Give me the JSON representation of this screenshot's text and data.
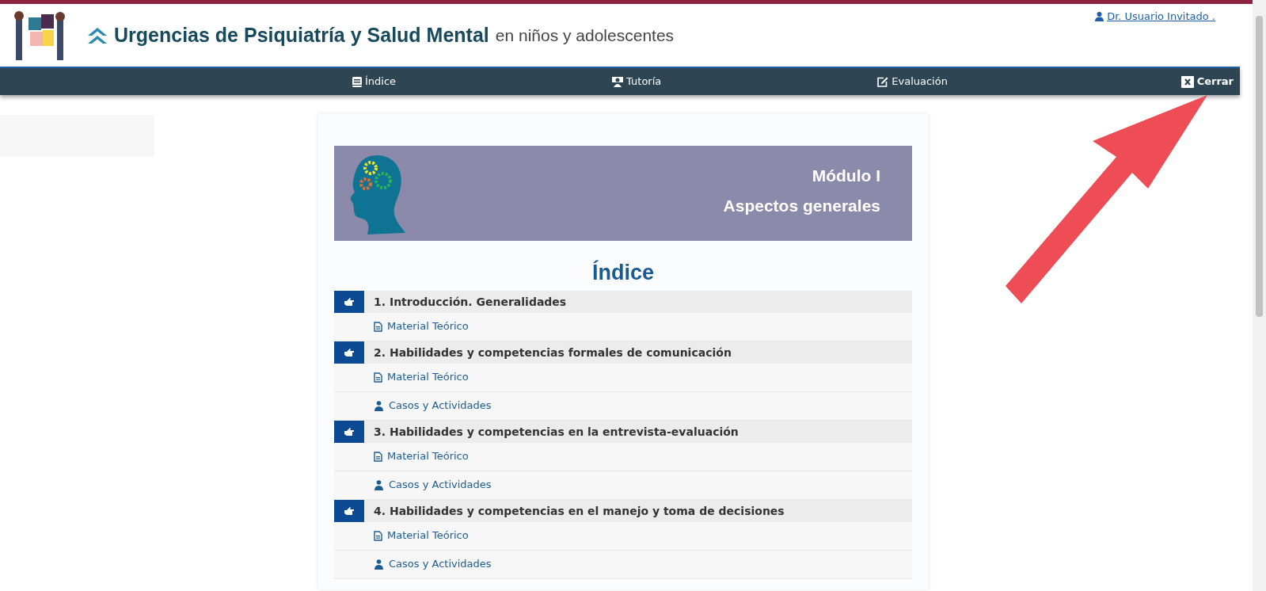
{
  "header": {
    "user": "Dr. Usuario Invitado .",
    "title": "Urgencias de Psiquiatría y Salud Mental",
    "subtitle": "en niños y adolescentes"
  },
  "nav": [
    {
      "label": "Índice",
      "kind": "book"
    },
    {
      "label": "Tutoría",
      "kind": "teacher"
    },
    {
      "label": "Evaluación",
      "kind": "edit"
    }
  ],
  "close": "Cerrar",
  "banner": {
    "module": "Módulo I",
    "name": "Aspectos generales"
  },
  "index_title": "Índice",
  "sections": [
    {
      "title": "1. Introducción. Generalidades",
      "items": [
        {
          "kind": "theory",
          "label": "Material Teórico"
        }
      ]
    },
    {
      "title": "2. Habilidades y competencias formales de comunicación",
      "items": [
        {
          "kind": "theory",
          "label": "Material Teórico"
        },
        {
          "kind": "cases",
          "label": "Casos y Actividades"
        }
      ]
    },
    {
      "title": "3. Habilidades y competencias en la entrevista-evaluación",
      "items": [
        {
          "kind": "theory",
          "label": "Material Teórico"
        },
        {
          "kind": "cases",
          "label": "Casos y Actividades"
        }
      ]
    },
    {
      "title": "4. Habilidades y competencias en el manejo y toma de decisiones",
      "items": [
        {
          "kind": "theory",
          "label": "Material Teórico"
        },
        {
          "kind": "cases",
          "label": "Casos y Actividades"
        }
      ]
    }
  ]
}
